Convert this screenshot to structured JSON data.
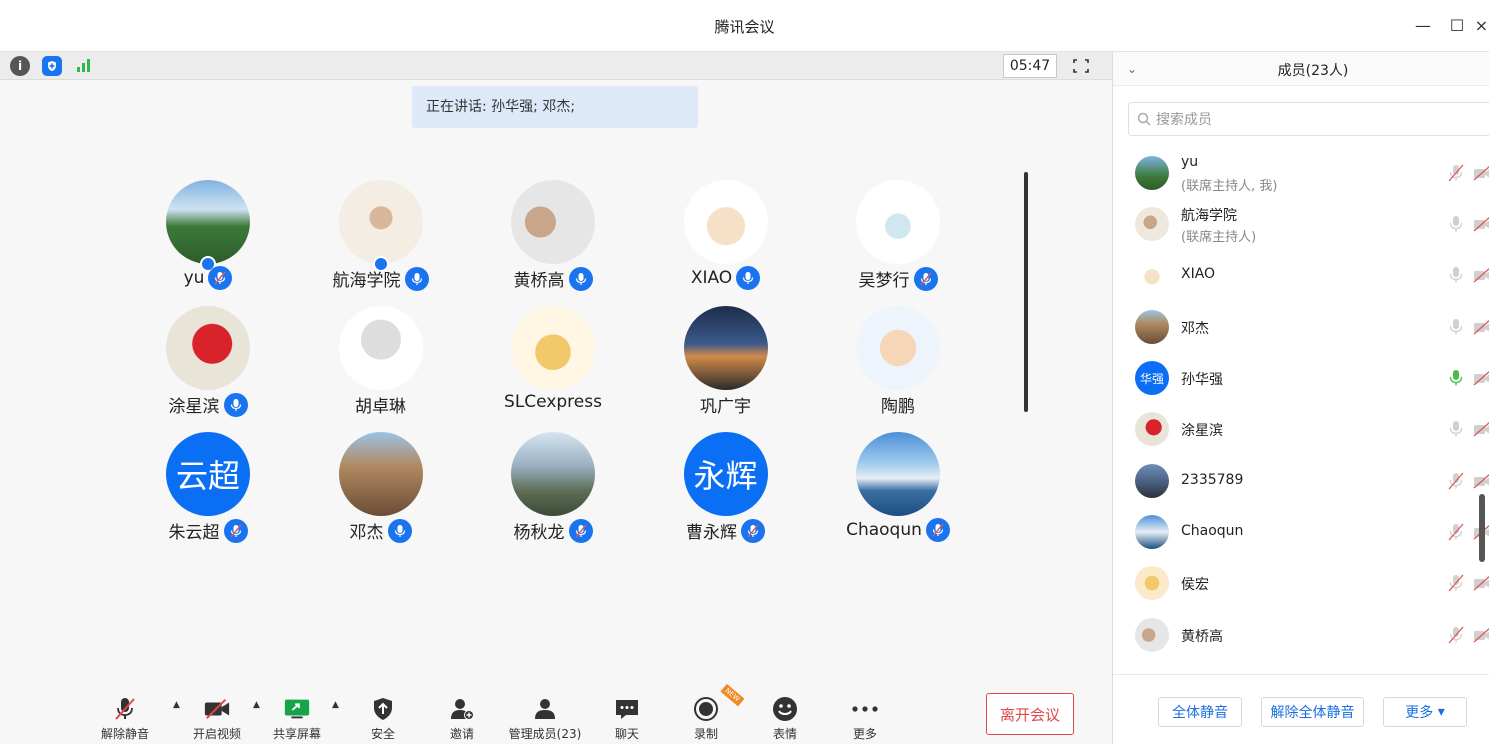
{
  "window": {
    "title": "腾讯会议",
    "minimize": "—",
    "maximize": "☐",
    "close": "×"
  },
  "topbar": {
    "timer": "05:47"
  },
  "speaking": "正在讲话: 孙华强; 邓杰;",
  "participants": [
    {
      "name": "yu"
    },
    {
      "name": "航海学院"
    },
    {
      "name": "黄桥高"
    },
    {
      "name": "XIAO"
    },
    {
      "name": "吴梦行"
    },
    {
      "name": "涂星滨"
    },
    {
      "name": "胡卓琳"
    },
    {
      "name": "SLCexpress"
    },
    {
      "name": "巩广宇"
    },
    {
      "name": "陶鹏"
    },
    {
      "name": "朱云超",
      "avatar_text": "云超"
    },
    {
      "name": "邓杰"
    },
    {
      "name": "杨秋龙"
    },
    {
      "name": "曹永辉",
      "avatar_text": "永辉"
    },
    {
      "name": "Chaoqun"
    }
  ],
  "toolbar": {
    "mute": "解除静音",
    "video": "开启视频",
    "share": "共享屏幕",
    "security": "安全",
    "invite": "邀请",
    "manage": "管理成员(23)",
    "chat": "聊天",
    "record": "录制",
    "record_badge": "NEW",
    "reaction": "表情",
    "more": "更多",
    "leave": "离开会议"
  },
  "side": {
    "title": "成员(23人)",
    "search_placeholder": "搜索成员",
    "members": [
      {
        "name": "yu",
        "role": "(联席主持人, 我)"
      },
      {
        "name": "航海学院",
        "role": "(联席主持人)"
      },
      {
        "name": "XIAO"
      },
      {
        "name": "邓杰"
      },
      {
        "name": "孙华强",
        "avatar_text": "华强"
      },
      {
        "name": "涂星滨"
      },
      {
        "name": "2335789"
      },
      {
        "name": "Chaoqun"
      },
      {
        "name": "侯宏"
      },
      {
        "name": "黄桥高"
      }
    ],
    "mute_all": "全体静音",
    "unmute_all": "解除全体静音",
    "more": "更多"
  },
  "colors": {
    "accent": "#1a74f0",
    "danger": "#e04848",
    "muted_icon": "#e05555",
    "speaking_icon": "#4cbb4c"
  }
}
